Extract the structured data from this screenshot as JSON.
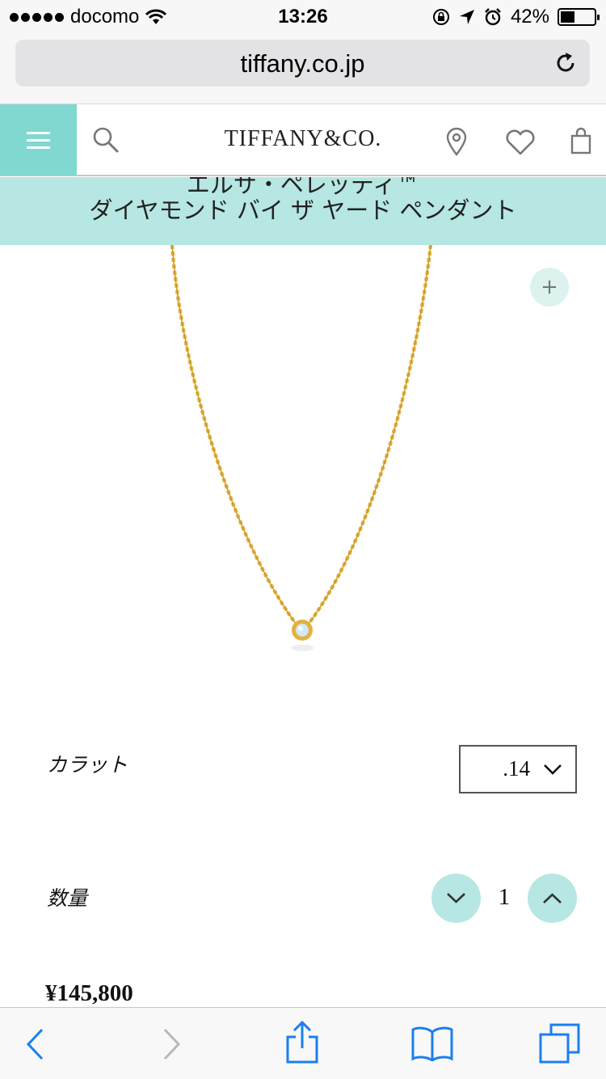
{
  "status_bar": {
    "carrier": "docomo",
    "time": "13:26",
    "battery": "42%",
    "battery_level": 0.42
  },
  "browser": {
    "url": "tiffany.co.jp"
  },
  "header": {
    "brand": "TIFFANY&CO."
  },
  "product": {
    "title_line1": "エルサ・ペレッティ™",
    "title_line2": "ダイヤモンド バイ ザ ヤード ペンダント",
    "zoom_label": "+",
    "carat_label": "カラット",
    "carat_value": ".14",
    "quantity_label": "数量",
    "quantity_value": "1",
    "price": "¥145,800"
  },
  "colors": {
    "accent": "#81d8d0",
    "band": "#b6e7e2",
    "ios_blue": "#1a7ff0"
  }
}
